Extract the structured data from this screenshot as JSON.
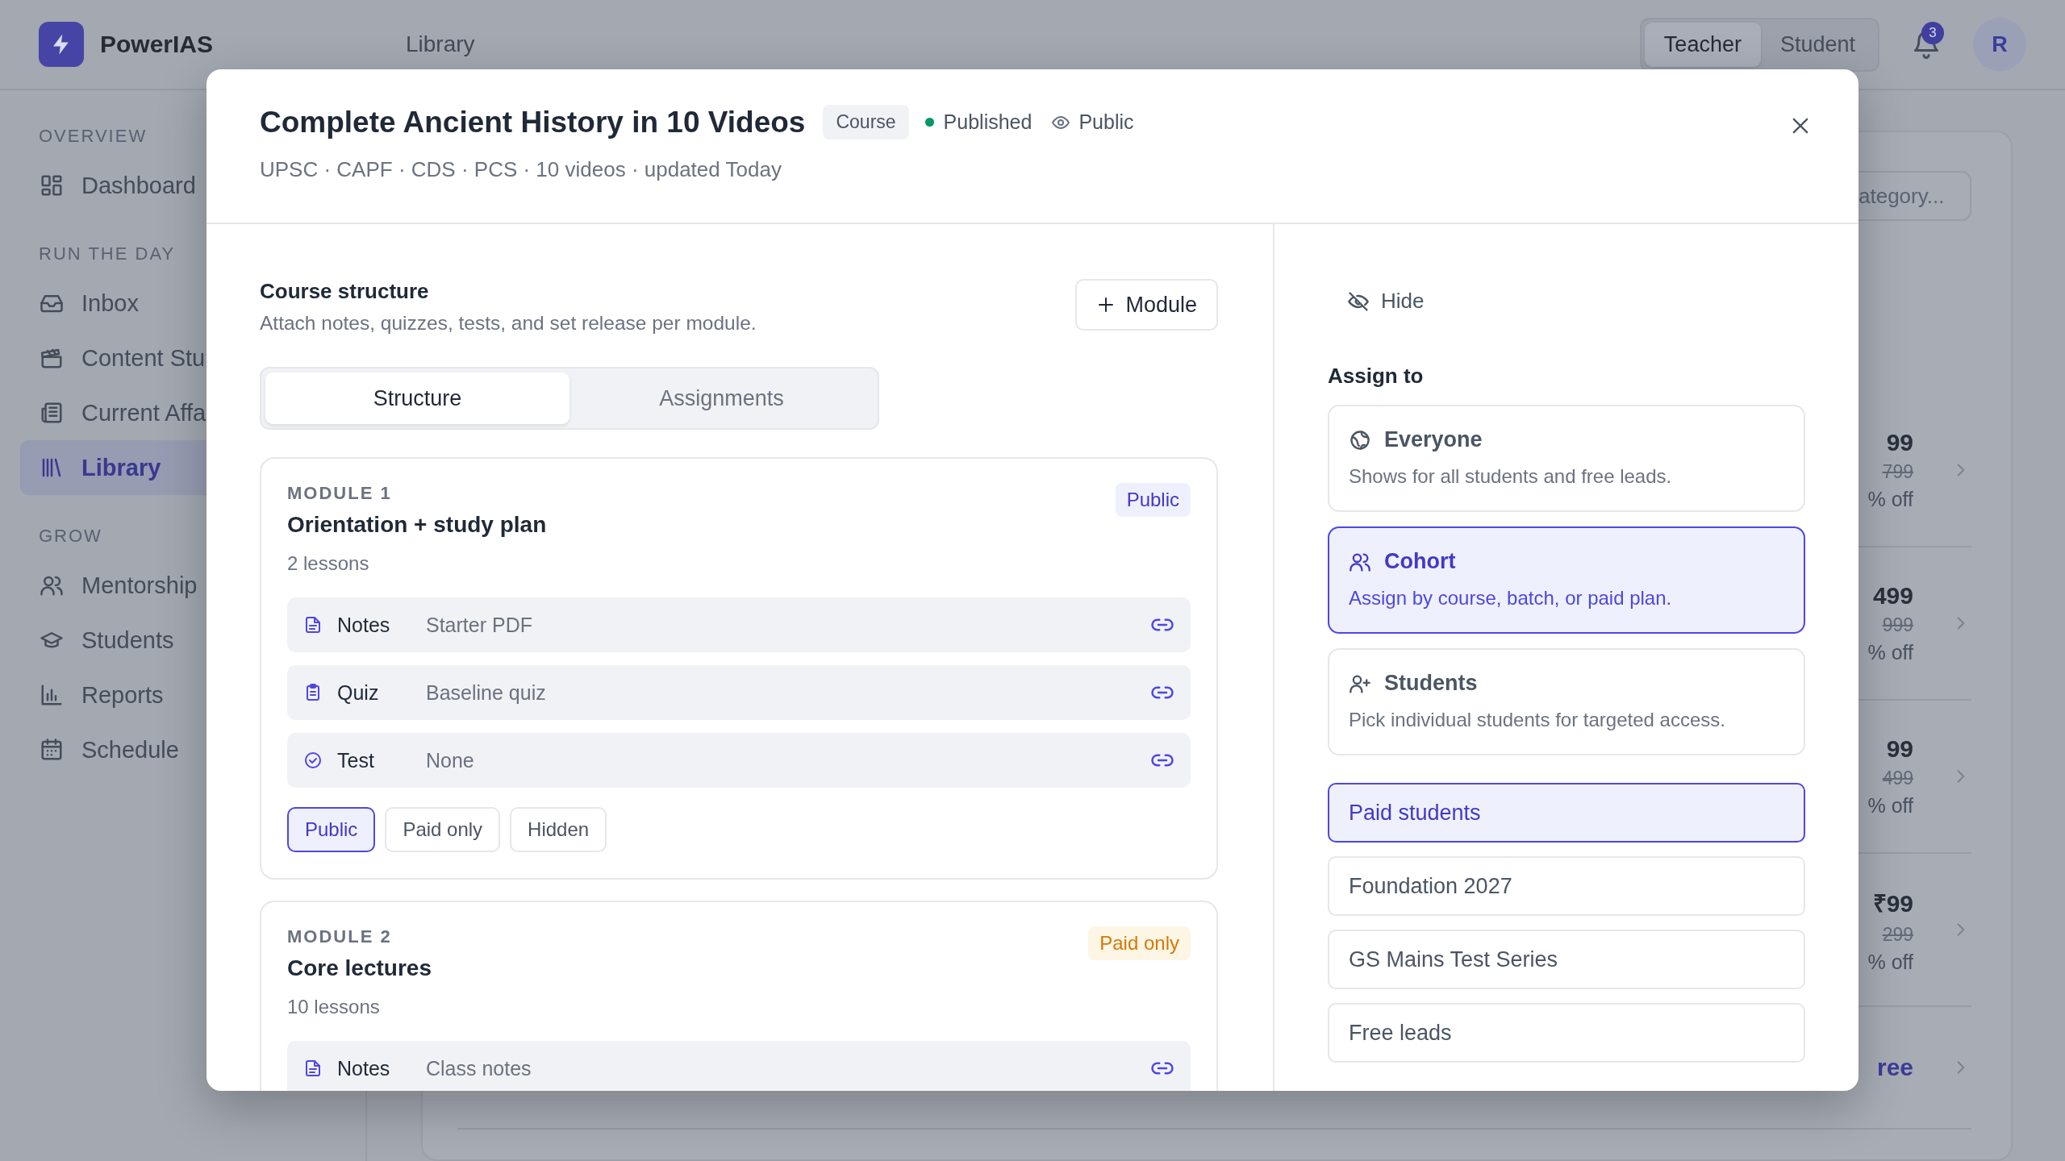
{
  "app": {
    "name": "PowerIAS"
  },
  "header": {
    "title": "Library",
    "roles": [
      {
        "label": "Teacher",
        "selected": true
      },
      {
        "label": "Student",
        "selected": false
      }
    ],
    "notifications": "3",
    "avatar": "R"
  },
  "sidebar": {
    "sections": [
      {
        "title": "OVERVIEW",
        "items": [
          {
            "label": "Dashboard",
            "selected": false
          }
        ]
      },
      {
        "title": "RUN THE DAY",
        "items": [
          {
            "label": "Inbox",
            "selected": false
          },
          {
            "label": "Content Stu",
            "selected": false
          },
          {
            "label": "Current Affa",
            "selected": false
          },
          {
            "label": "Library",
            "selected": true
          }
        ]
      },
      {
        "title": "GROW",
        "items": [
          {
            "label": "Mentorship",
            "selected": false
          },
          {
            "label": "Students",
            "selected": false
          },
          {
            "label": "Reports",
            "selected": false
          },
          {
            "label": "Schedule",
            "selected": false
          }
        ]
      }
    ]
  },
  "background": {
    "search": {
      "placeholder": "ategory..."
    },
    "rows": [
      {
        "price": "99",
        "old_price": "799",
        "discount": "% off"
      },
      {
        "price": "499",
        "old_price": "999",
        "discount": "% off"
      },
      {
        "price": "99",
        "old_price": "499",
        "discount": "% off"
      },
      {
        "price": "₹99",
        "old_price": "299",
        "discount": "% off"
      },
      {
        "price": "ree"
      }
    ]
  },
  "modal": {
    "title": "Complete Ancient History in 10 Videos",
    "type": "Course",
    "status": "Published",
    "visibility": "Public",
    "meta": "UPSC · CAPF · CDS · PCS · 10 videos · updated Today",
    "structure": {
      "title": "Course structure",
      "description": "Attach notes, quizzes, tests, and set release per module.",
      "add_button": "Module",
      "tabs": [
        {
          "label": "Structure",
          "selected": true
        },
        {
          "label": "Assignments",
          "selected": false
        }
      ],
      "modules": [
        {
          "label": "MODULE 1",
          "title": "Orientation + study plan",
          "lessons": "2 lessons",
          "badge": {
            "text": "Public",
            "kind": "public"
          },
          "items": [
            {
              "kind": "notes",
              "type": "Notes",
              "value": "Starter PDF"
            },
            {
              "kind": "quiz",
              "type": "Quiz",
              "value": "Baseline quiz"
            },
            {
              "kind": "test",
              "type": "Test",
              "value": "None"
            }
          ],
          "release": [
            {
              "label": "Public",
              "selected": true
            },
            {
              "label": "Paid only",
              "selected": false
            },
            {
              "label": "Hidden",
              "selected": false
            }
          ]
        },
        {
          "label": "MODULE 2",
          "title": "Core lectures",
          "lessons": "10 lessons",
          "badge": {
            "text": "Paid only",
            "kind": "paid"
          },
          "items": [
            {
              "kind": "notes",
              "type": "Notes",
              "value": "Class notes"
            }
          ]
        }
      ]
    },
    "assign": {
      "hide": "Hide",
      "title": "Assign to",
      "targets": [
        {
          "kind": "everyone",
          "title": "Everyone",
          "description": "Shows for all students and free leads.",
          "selected": false
        },
        {
          "kind": "cohort",
          "title": "Cohort",
          "description": "Assign by course, batch, or paid plan.",
          "selected": true
        },
        {
          "kind": "students",
          "title": "Students",
          "description": "Pick individual students for targeted access.",
          "selected": false
        }
      ],
      "groups": [
        {
          "label": "Paid students",
          "selected": true
        },
        {
          "label": "Foundation 2027",
          "selected": false
        },
        {
          "label": "GS Mains Test Series",
          "selected": false
        },
        {
          "label": "Free leads",
          "selected": false
        }
      ]
    }
  }
}
